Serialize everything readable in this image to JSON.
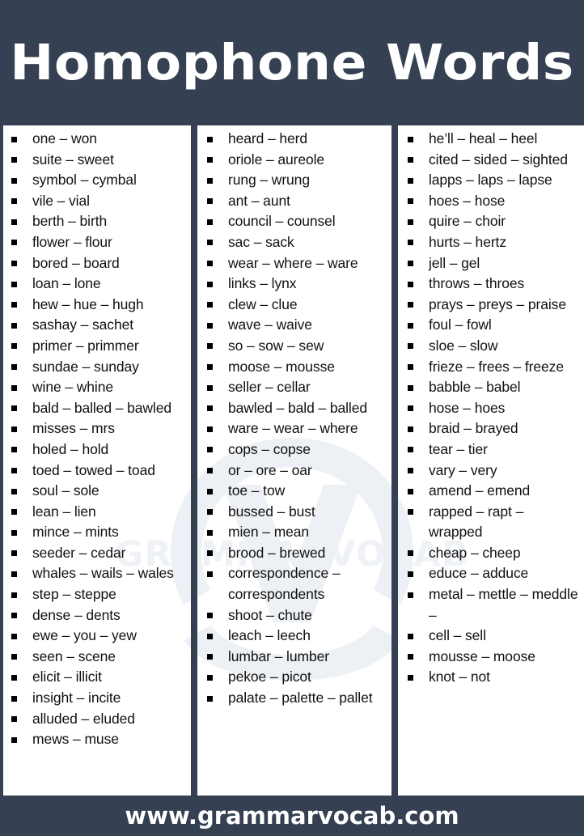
{
  "header": {
    "title": "Homophone Words"
  },
  "footer": {
    "website": "www.grammarvocab.com"
  },
  "watermark": {
    "text": "GRAMMARVOCAB",
    "color": "#eef1f5"
  },
  "theme": {
    "dark": "#354052",
    "page": "#ffffff",
    "text": "#111111",
    "bullet": "#000000"
  },
  "columns": [
    {
      "name": "column-1",
      "items": [
        "one – won",
        "suite – sweet",
        "symbol – cymbal",
        "vile – vial",
        "berth – birth",
        "flower – flour",
        "bored – board",
        "loan – lone",
        "hew – hue – hugh",
        "sashay – sachet",
        "primer – primmer",
        "sundae – sunday",
        "wine – whine",
        "bald – balled – bawled",
        "misses – mrs",
        "holed – hold",
        "toed – towed – toad",
        "soul – sole",
        "lean – lien",
        "mince – mints",
        "seeder  – cedar",
        "whales – wails – wales",
        "step – steppe",
        "dense – dents",
        "ewe – you – yew",
        "seen – scene",
        "elicit – illicit",
        "insight – incite",
        "alluded – eluded",
        "mews – muse"
      ]
    },
    {
      "name": "column-2",
      "items": [
        "heard – herd",
        "oriole – aureole",
        "rung – wrung",
        "ant – aunt",
        "council – counsel",
        "sac – sack",
        "wear – where – ware",
        "links – lynx",
        "clew – clue",
        "wave – waive",
        "so – sow – sew",
        "moose – mousse",
        "seller – cellar",
        "bawled – bald – balled",
        "ware – wear – where",
        "cops – copse",
        "or – ore – oar",
        "toe – tow",
        "bussed – bust",
        "mien – mean",
        "brood – brewed",
        "correspondence  – correspondents",
        "shoot – chute",
        "leach – leech",
        "lumbar – lumber",
        "pekoe – picot",
        "palate – palette – pallet"
      ]
    },
    {
      "name": "column-3",
      "items": [
        "he’ll – heal – heel",
        "cited – sided – sighted",
        "lapps – laps – lapse",
        "hoes – hose",
        "quire – choir",
        "hurts – hertz",
        "jell – gel",
        "throws – throes",
        "prays – preys – praise",
        "foul – fowl",
        "sloe – slow",
        "frieze – frees  – freeze",
        "babble – babel",
        "hose – hoes",
        "braid – brayed",
        "tear – tier",
        "vary – very",
        "amend – emend",
        "rapped – rapt – wrapped",
        "cheap – cheep",
        "educe – adduce",
        "metal – mettle – meddle –",
        "cell – sell",
        "mousse – moose",
        "knot – not"
      ]
    }
  ]
}
